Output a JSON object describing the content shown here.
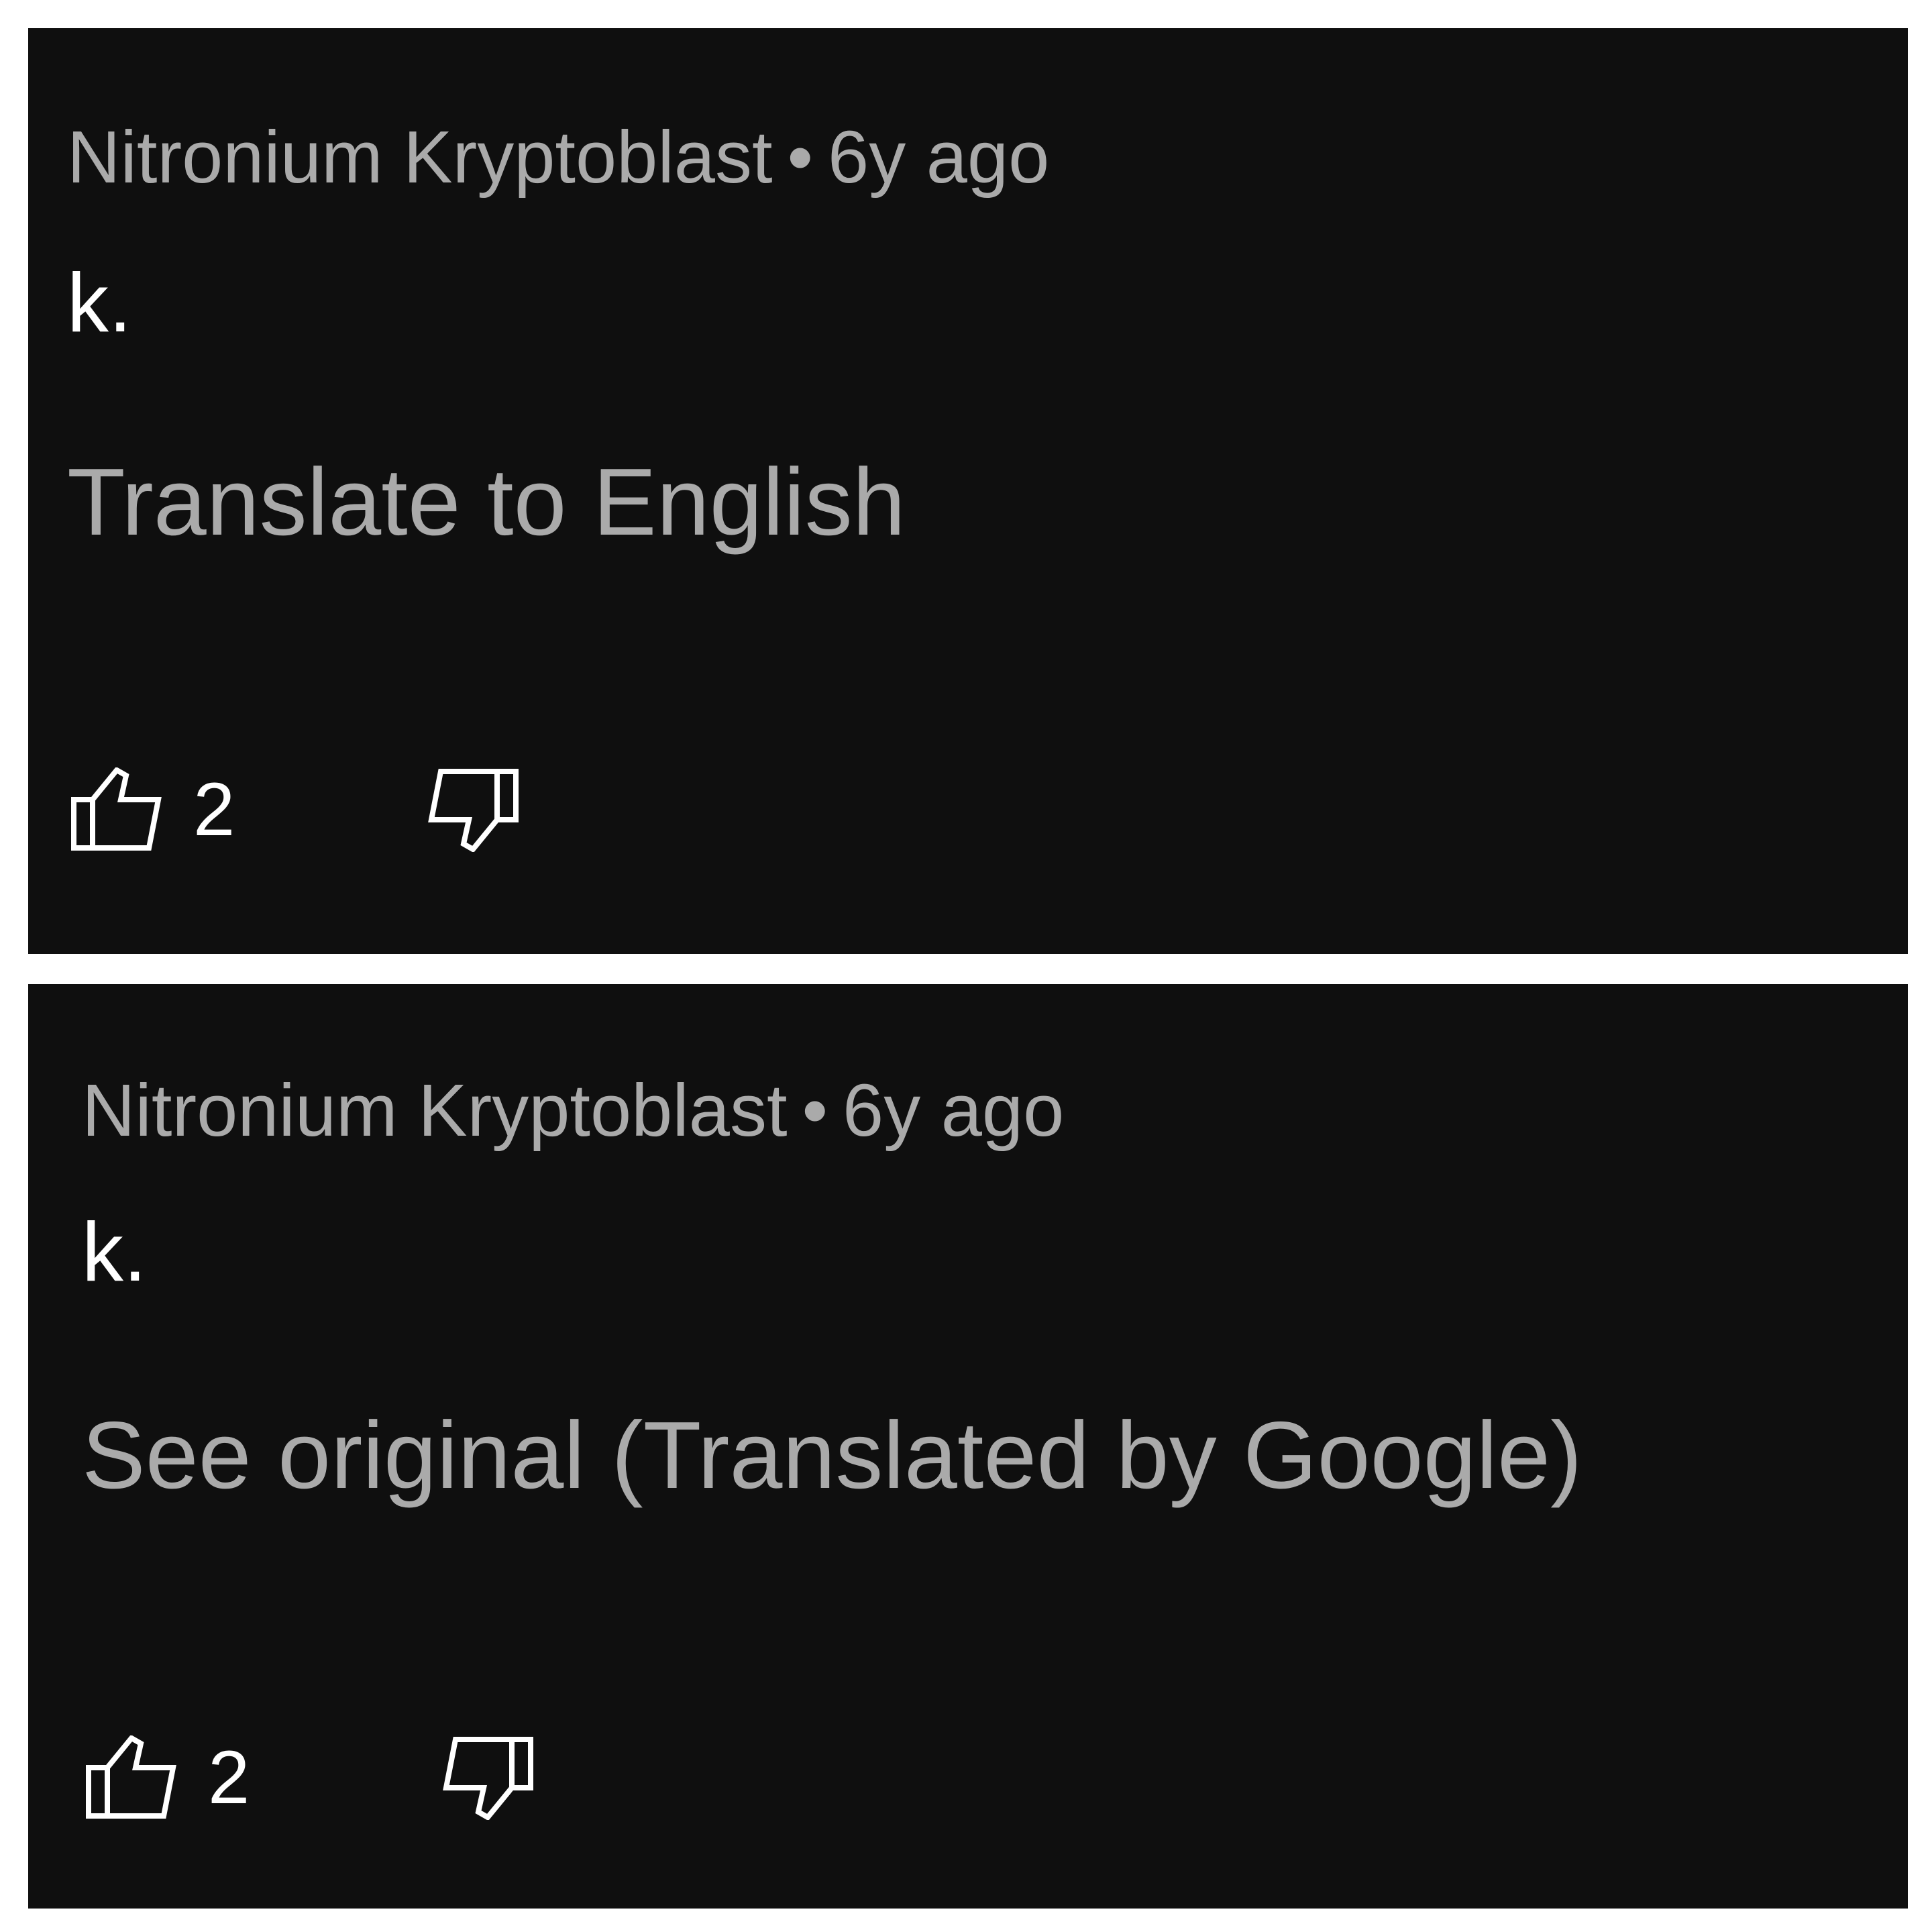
{
  "comments": [
    {
      "author": "Nitronium Kryptoblast",
      "separator": "•",
      "timestamp": "6y ago",
      "text": "k.",
      "translate_link": "Translate to English",
      "like_count": "2"
    },
    {
      "author": "Nitronium Kryptoblast",
      "separator": "•",
      "timestamp": "6y ago",
      "text": "k.",
      "translate_link": "See original (Translated by Google)",
      "like_count": "2"
    }
  ],
  "icons": {
    "like": "thumbs-up-icon",
    "dislike": "thumbs-down-icon"
  },
  "colors": {
    "background": "#0f0f0f",
    "page_background": "#ffffff",
    "primary_text": "#ffffff",
    "secondary_text": "#aaaaaa"
  }
}
